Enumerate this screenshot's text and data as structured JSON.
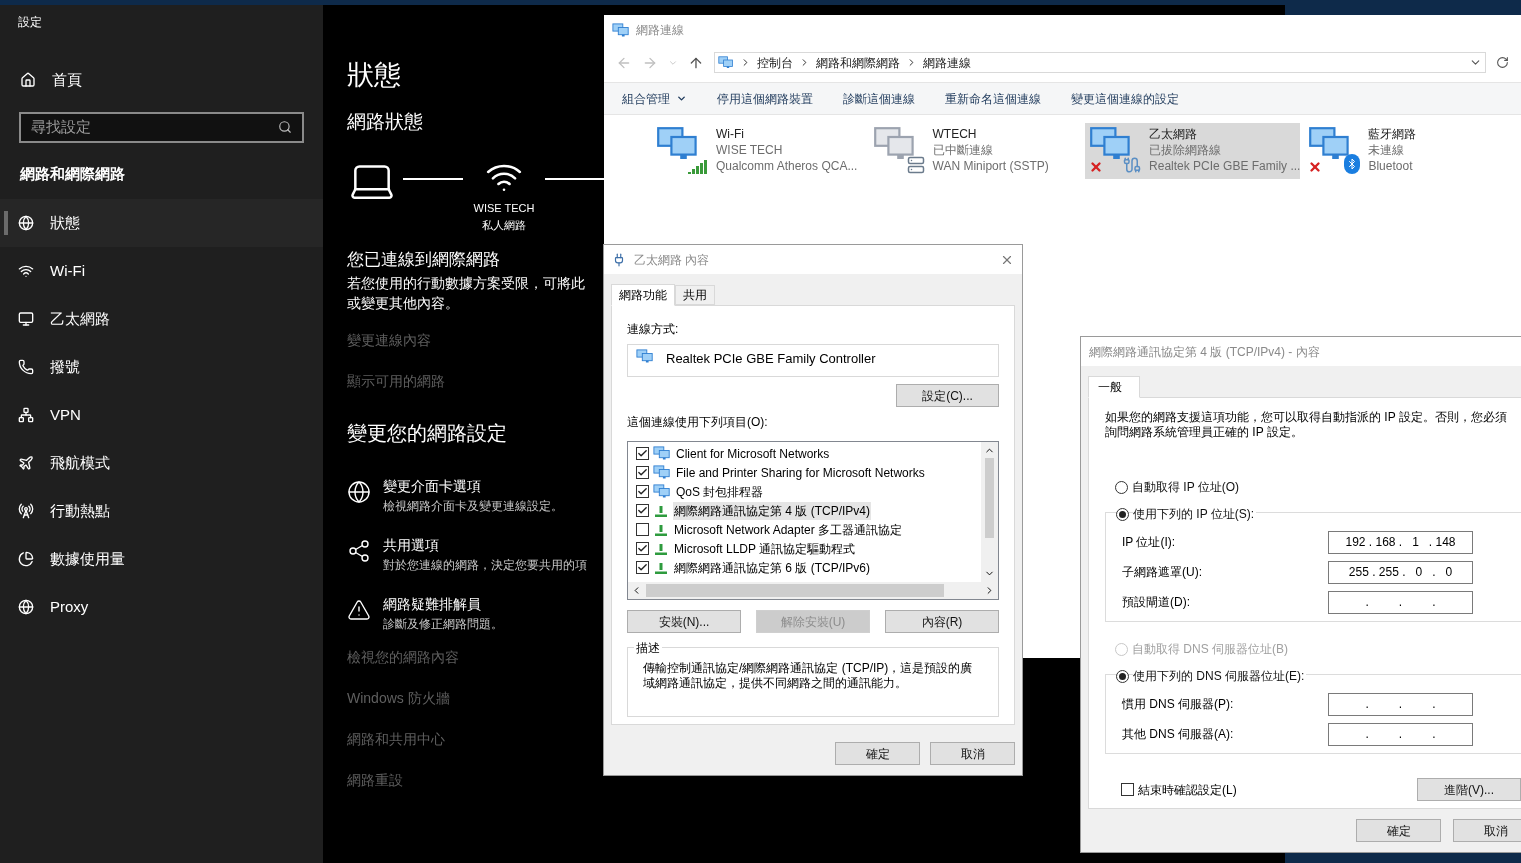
{
  "settings": {
    "title": "設定",
    "home": "首頁",
    "search": {
      "placeholder": "尋找設定"
    },
    "section": "網路和網際網路",
    "nav": [
      {
        "label": "狀態",
        "selected": true
      },
      {
        "label": "Wi-Fi",
        "selected": false
      },
      {
        "label": "乙太網路",
        "selected": false
      },
      {
        "label": "撥號",
        "selected": false
      },
      {
        "label": "VPN",
        "selected": false
      },
      {
        "label": "飛航模式",
        "selected": false
      },
      {
        "label": "行動熱點",
        "selected": false
      },
      {
        "label": "數據使用量",
        "selected": false
      },
      {
        "label": "Proxy",
        "selected": false
      }
    ],
    "page": {
      "title": "狀態",
      "subtitle": "網路狀態",
      "network_name": "WISE TECH",
      "network_profile": "私人網路",
      "connected_title": "您已連線到網際網路",
      "connected_text": [
        "若您使用的行動數據方案受限，可將此",
        "或變更其他內容。"
      ],
      "links": [
        "變更連線內容",
        "顯示可用的網路"
      ],
      "change_title": "變更您的網路設定",
      "options": [
        {
          "title": "變更介面卡選項",
          "description": "檢視網路介面卡及變更連線設定。"
        },
        {
          "title": "共用選項",
          "description": "對於您連線的網路，決定您要共用的項"
        },
        {
          "title": "網路疑難排解員",
          "description": "診斷及修正網路問題。"
        }
      ],
      "more_links": [
        "檢視您的網路內容",
        "Windows 防火牆",
        "網路和共用中心",
        "網路重設"
      ]
    }
  },
  "network_connections": {
    "title": "網路連線",
    "breadcrumb": [
      "控制台",
      "網路和網際網路",
      "網路連線"
    ],
    "toolbar": [
      {
        "label": "組合管理",
        "kind": "menu"
      },
      {
        "label": "停用這個網路裝置",
        "kind": "command"
      },
      {
        "label": "診斷這個連線",
        "kind": "command"
      },
      {
        "label": "重新命名這個連線",
        "kind": "command"
      },
      {
        "label": "變更這個連線的設定",
        "kind": "command"
      }
    ],
    "adapters": [
      {
        "name": "Wi-Fi",
        "status": "WISE TECH",
        "device": "Qualcomm Atheros QCA...",
        "kind": "wifi",
        "error": false,
        "selected": false
      },
      {
        "name": "WTECH",
        "status": "已中斷連線",
        "device": "WAN Miniport (SSTP)",
        "kind": "vpn",
        "error": false,
        "selected": false
      },
      {
        "name": "乙太網路",
        "status": "已拔除網路線",
        "device": "Realtek PCIe GBE Family ...",
        "kind": "ethernet",
        "error": true,
        "selected": true
      },
      {
        "name": "藍牙網路",
        "status": "未連線",
        "device": "Bluetoot",
        "kind": "bluetooth",
        "error": true,
        "selected": false
      }
    ]
  },
  "ethernet_dialog": {
    "title": "乙太網路 內容",
    "tabs": [
      {
        "label": "網路功能",
        "selected": true
      },
      {
        "label": "共用",
        "selected": false
      }
    ],
    "connect_using_label": "連線方式:",
    "adapter": "Realtek PCIe GBE Family Controller",
    "configure_button": "設定(C)...",
    "items_label": "這個連線使用下列項目(O):",
    "items": [
      {
        "label": "Client for Microsoft Networks",
        "kind": "client",
        "checked": true,
        "selected": false
      },
      {
        "label": "File and Printer Sharing for Microsoft Networks",
        "kind": "client",
        "checked": true,
        "selected": false
      },
      {
        "label": "QoS 封包排程器",
        "kind": "client",
        "checked": true,
        "selected": false
      },
      {
        "label": "網際網路通訊協定第 4 版 (TCP/IPv4)",
        "kind": "protocol",
        "checked": true,
        "selected": true
      },
      {
        "label": "Microsoft Network Adapter 多工器通訊協定",
        "kind": "protocol",
        "checked": false,
        "selected": false
      },
      {
        "label": "Microsoft LLDP 通訊協定驅動程式",
        "kind": "protocol",
        "checked": true,
        "selected": false
      },
      {
        "label": "網際網路通訊協定第 6 版 (TCP/IPv6)",
        "kind": "protocol",
        "checked": true,
        "selected": false
      }
    ],
    "buttons": [
      {
        "label": "安裝(N)...",
        "disabled": false
      },
      {
        "label": "解除安裝(U)",
        "disabled": true
      },
      {
        "label": "內容(R)",
        "disabled": false
      }
    ],
    "description_label": "描述",
    "description": "傳輸控制通訊協定/網際網路通訊協定 (TCP/IP)，這是預設的廣域網路通訊協定，提供不同網路之間的通訊能力。",
    "footer_buttons": [
      "確定",
      "取消"
    ]
  },
  "ipv4_dialog": {
    "title": "網際網路通訊協定第 4 版 (TCP/IPv4) - 內容",
    "tabs": [
      {
        "label": "一般",
        "selected": true
      }
    ],
    "intro": "如果您的網路支援這項功能，您可以取得自動指派的 IP 設定。否則，您必須詢問網路系統管理員正確的 IP 設定。",
    "ip_choice": [
      {
        "label": "自動取得 IP 位址(O)",
        "selected": false,
        "disabled": false
      },
      {
        "label": "使用下列的 IP 位址(S):",
        "selected": true,
        "disabled": false
      }
    ],
    "ip_fields": [
      {
        "label": "IP 位址(I):",
        "value": "192 . 168 .   1   . 148"
      },
      {
        "label": "子網路遮罩(U):",
        "value": "255 . 255 .   0   .   0"
      },
      {
        "label": "預設閘道(D):",
        "value": ".         .         ."
      }
    ],
    "dns_choice": [
      {
        "label": "自動取得 DNS 伺服器位址(B)",
        "selected": false,
        "disabled": true
      },
      {
        "label": "使用下列的 DNS 伺服器位址(E):",
        "selected": true,
        "disabled": false
      }
    ],
    "dns_fields": [
      {
        "label": "慣用 DNS 伺服器(P):",
        "value": ".         .         ."
      },
      {
        "label": "其他 DNS 伺服器(A):",
        "value": ".         .         ."
      }
    ],
    "validate": {
      "label": "結束時確認設定(L)",
      "checked": false
    },
    "advanced_button": "進階(V)...",
    "footer_buttons": [
      "確定",
      "取消"
    ]
  }
}
